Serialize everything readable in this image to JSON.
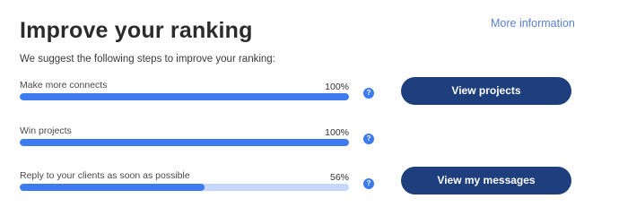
{
  "header": {
    "title": "Improve your ranking",
    "more_link": "More information",
    "subtitle": "We suggest the following steps to improve your ranking:"
  },
  "steps": [
    {
      "label": "Make more connects",
      "percent_text": "100%",
      "progress": 100,
      "help_icon": "question-mark"
    },
    {
      "label": "Win projects",
      "percent_text": "100%",
      "progress": 100,
      "help_icon": "question-mark"
    },
    {
      "label": "Reply to your clients as soon as possible",
      "percent_text": "56%",
      "progress": 56,
      "help_icon": "question-mark"
    }
  ],
  "buttons": {
    "view_projects": "View projects",
    "view_messages": "View my messages"
  },
  "colors": {
    "accent": "#3d7bf0",
    "track": "#c5d8fb",
    "button": "#1f3e7d",
    "link": "#5b80d6"
  }
}
